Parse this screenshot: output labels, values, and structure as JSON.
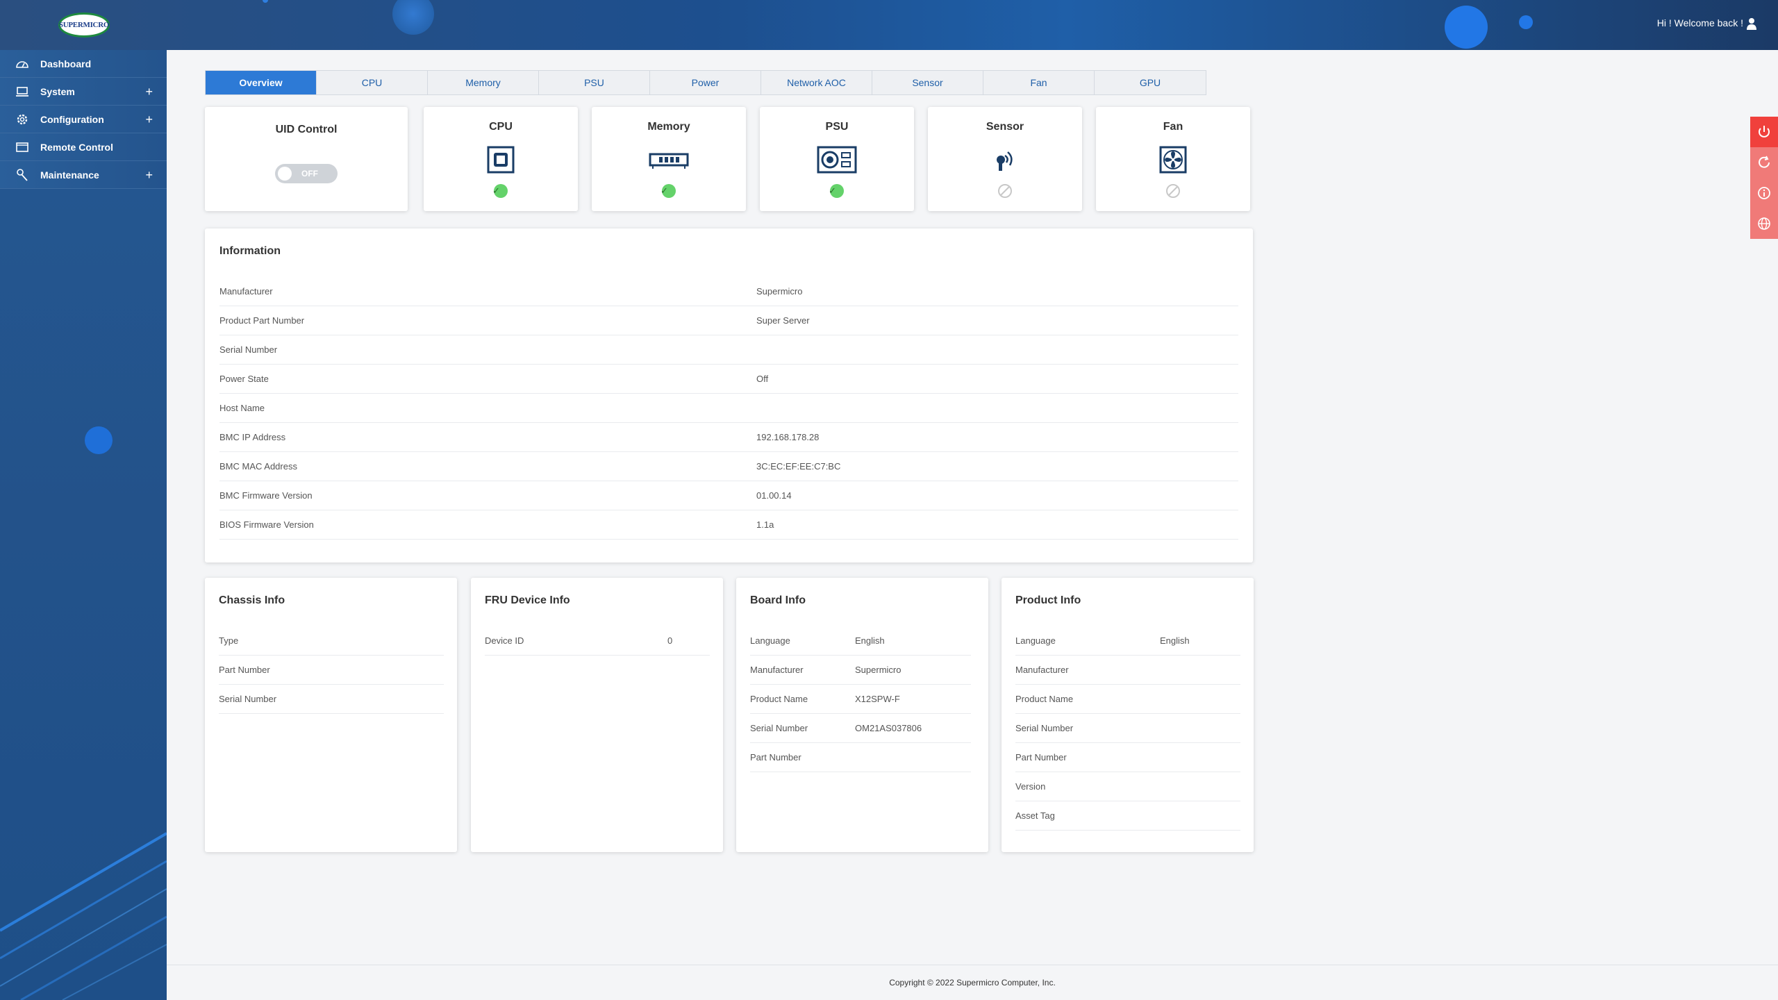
{
  "header": {
    "logo_text": "SUPERMICRO",
    "welcome": "Hi ! Welcome back !"
  },
  "sidebar": {
    "items": [
      {
        "label": "Dashboard",
        "icon": "dashboard-icon",
        "expandable": false
      },
      {
        "label": "System",
        "icon": "laptop-icon",
        "expandable": true
      },
      {
        "label": "Configuration",
        "icon": "gear-icon",
        "expandable": true
      },
      {
        "label": "Remote Control",
        "icon": "console-icon",
        "expandable": false
      },
      {
        "label": "Maintenance",
        "icon": "wrench-icon",
        "expandable": true
      }
    ],
    "expand_symbol": "+"
  },
  "tabs": [
    "Overview",
    "CPU",
    "Memory",
    "PSU",
    "Power",
    "Network AOC",
    "Sensor",
    "Fan",
    "GPU"
  ],
  "active_tab": "Overview",
  "uid": {
    "title": "UID Control",
    "state": "OFF"
  },
  "status_cards": [
    {
      "title": "CPU",
      "icon": "cpu-icon",
      "status": "ok"
    },
    {
      "title": "Memory",
      "icon": "memory-icon",
      "status": "ok"
    },
    {
      "title": "PSU",
      "icon": "psu-icon",
      "status": "ok"
    },
    {
      "title": "Sensor",
      "icon": "sensor-icon",
      "status": "na"
    },
    {
      "title": "Fan",
      "icon": "fan-icon",
      "status": "na"
    }
  ],
  "information": {
    "title": "Information",
    "rows": [
      {
        "k": "Manufacturer",
        "v": "Supermicro"
      },
      {
        "k": "Product Part Number",
        "v": "Super Server"
      },
      {
        "k": "Serial Number",
        "v": ""
      },
      {
        "k": "Power State",
        "v": "Off"
      },
      {
        "k": "Host Name",
        "v": ""
      },
      {
        "k": "BMC IP Address",
        "v": "192.168.178.28"
      },
      {
        "k": "BMC MAC Address",
        "v": "3C:EC:EF:EE:C7:BC"
      },
      {
        "k": "BMC Firmware Version",
        "v": "01.00.14"
      },
      {
        "k": "BIOS Firmware Version",
        "v": "1.1a"
      }
    ]
  },
  "chassis": {
    "title": "Chassis Info",
    "rows": [
      {
        "k": "Type",
        "v": ""
      },
      {
        "k": "Part Number",
        "v": ""
      },
      {
        "k": "Serial Number",
        "v": ""
      }
    ]
  },
  "fru": {
    "title": "FRU Device Info",
    "rows": [
      {
        "k": "Device ID",
        "v": "0"
      }
    ]
  },
  "board": {
    "title": "Board Info",
    "rows": [
      {
        "k": "Language",
        "v": "English"
      },
      {
        "k": "Manufacturer",
        "v": "Supermicro"
      },
      {
        "k": "Product Name",
        "v": "X12SPW-F"
      },
      {
        "k": "Serial Number",
        "v": "OM21AS037806"
      },
      {
        "k": "Part Number",
        "v": ""
      }
    ]
  },
  "product": {
    "title": "Product Info",
    "rows": [
      {
        "k": "Language",
        "v": "English"
      },
      {
        "k": "Manufacturer",
        "v": ""
      },
      {
        "k": "Product Name",
        "v": ""
      },
      {
        "k": "Serial Number",
        "v": ""
      },
      {
        "k": "Part Number",
        "v": ""
      },
      {
        "k": "Version",
        "v": ""
      },
      {
        "k": "Asset Tag",
        "v": ""
      }
    ]
  },
  "side_actions": [
    {
      "icon": "power-icon",
      "color": "#f0403c"
    },
    {
      "icon": "refresh-icon",
      "color": "#f07a78"
    },
    {
      "icon": "info-icon",
      "color": "#f07a78"
    },
    {
      "icon": "globe-icon",
      "color": "#f07a78"
    }
  ],
  "footer": {
    "copyright": "Copyright © 2022 Supermicro Computer, Inc."
  },
  "colors": {
    "accent": "#2d7ad6",
    "ok": "#64d26a",
    "danger": "#f0403c"
  }
}
